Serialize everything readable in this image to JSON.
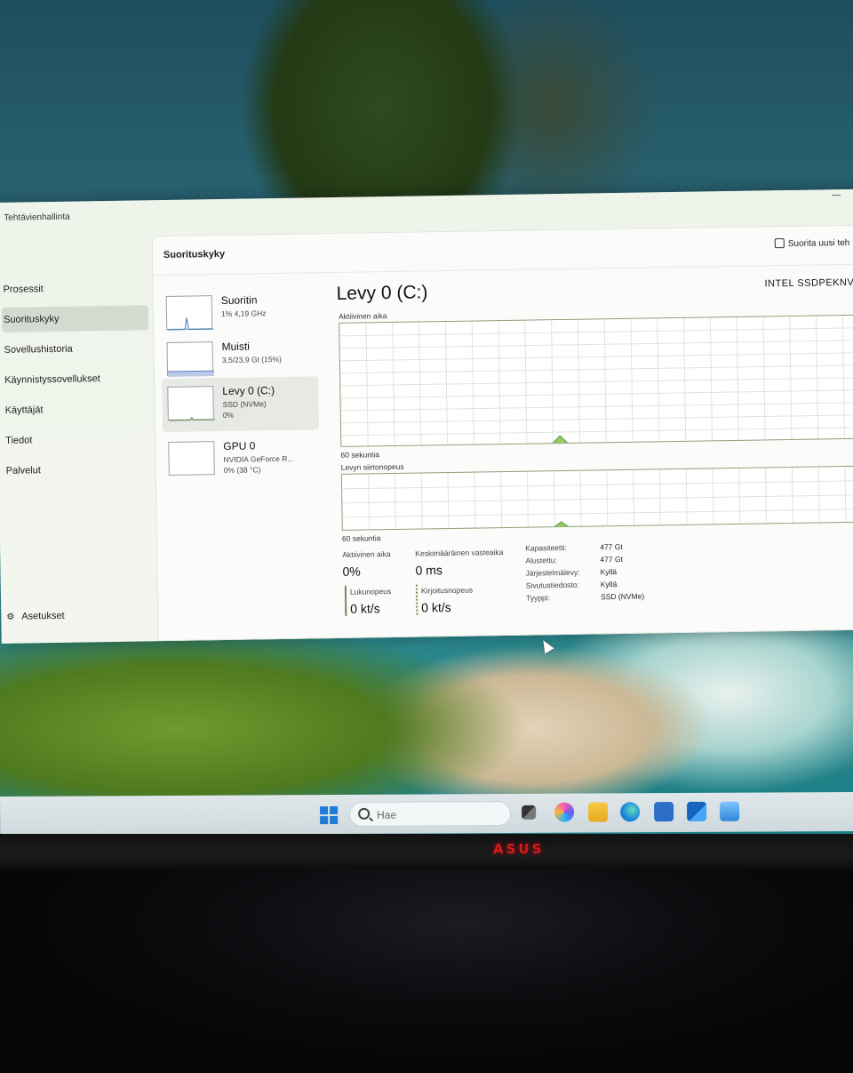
{
  "window": {
    "title": "Tehtävienhallinta"
  },
  "nav": {
    "items": [
      "Prosessit",
      "Suorituskyky",
      "Sovellushistoria",
      "Käynnistyssovellukset",
      "Käyttäjät",
      "Tiedot",
      "Palvelut"
    ],
    "active_index": 1,
    "settings_label": "Asetukset"
  },
  "header": {
    "title": "Suorituskyky",
    "run_task_label": "Suorita uusi teh"
  },
  "devices": [
    {
      "name": "Suoritin",
      "sub1": "1% 4,19 GHz",
      "sub2": ""
    },
    {
      "name": "Muisti",
      "sub1": "3,5/23,9 Gt (15%)",
      "sub2": ""
    },
    {
      "name": "Levy 0 (C:)",
      "sub1": "SSD (NVMe)",
      "sub2": "0%"
    },
    {
      "name": "GPU 0",
      "sub1": "NVIDIA GeForce R...",
      "sub2": "0% (38 °C)"
    }
  ],
  "active_device_index": 2,
  "disk": {
    "title": "Levy 0 (C:)",
    "model": "INTEL SSDPEKNV",
    "graph1_label": "Aktiivinen aika",
    "graph1_footer": "60 sekuntia",
    "graph2_label": "Levyn siirtonopeus",
    "graph2_footer": "60 sekuntia",
    "active_time_label": "Aktiivinen aika",
    "active_time_value": "0%",
    "avg_response_label": "Keskimääräinen vasteaika",
    "avg_response_value": "0 ms",
    "read_label": "Lukunopeus",
    "read_value": "0 kt/s",
    "write_label": "Kirjoitusnopeus",
    "write_value": "0 kt/s",
    "props": [
      {
        "k": "Kapasiteetti:",
        "v": "477 Gt"
      },
      {
        "k": "Alustettu:",
        "v": "477 Gt"
      },
      {
        "k": "Järjestelmälevy:",
        "v": "Kyllä"
      },
      {
        "k": "Sivutustiedosto:",
        "v": "Kyllä"
      },
      {
        "k": "Tyyppi:",
        "v": "SSD (NVMe)"
      }
    ]
  },
  "taskbar": {
    "search_placeholder": "Hae",
    "icons": [
      "start-icon",
      "task-view-icon",
      "copilot-icon",
      "file-explorer-icon",
      "edge-icon",
      "store-icon",
      "outlook-icon",
      "photos-icon"
    ]
  },
  "monitor": {
    "brand": "ASUS"
  },
  "colors": {
    "accent": "#1f7ad8",
    "graph_line": "#6e8d55",
    "graph_fill": "#8fcf5a"
  }
}
